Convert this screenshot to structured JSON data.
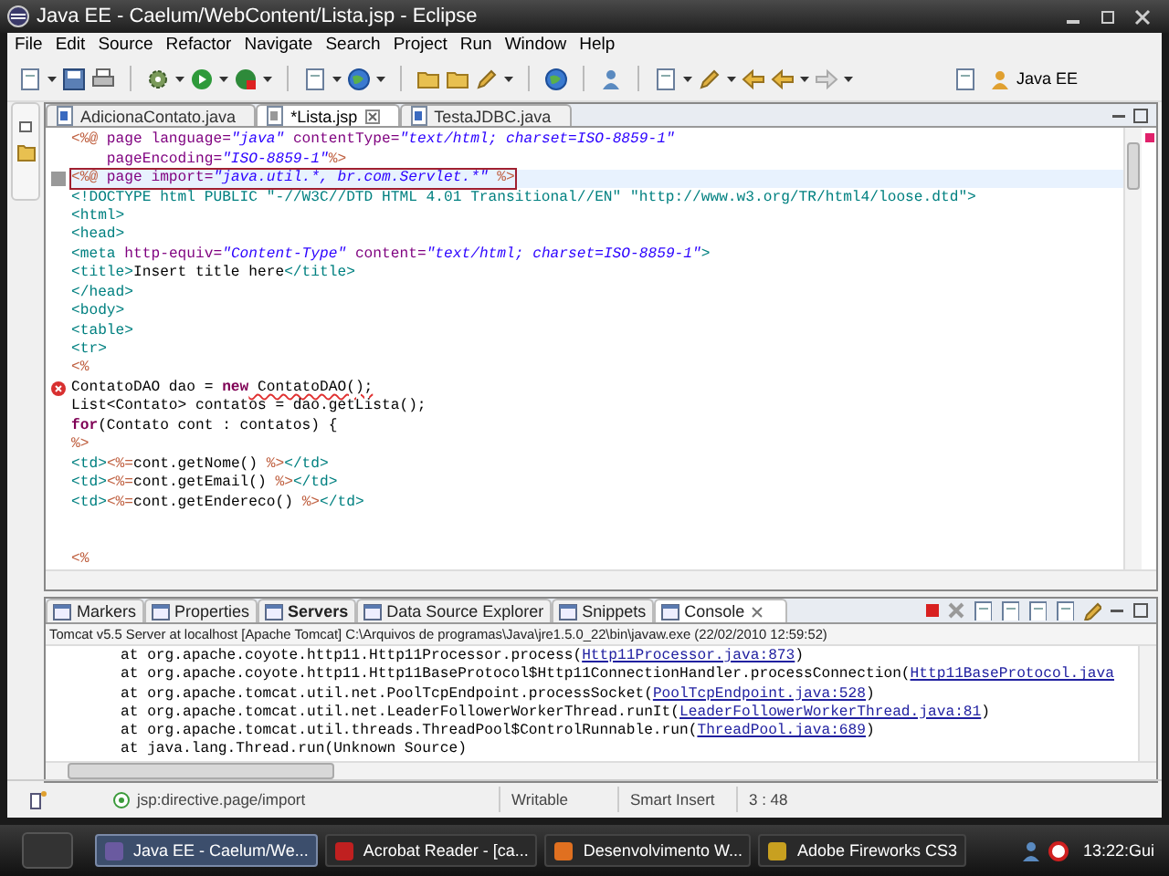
{
  "window": {
    "title": "Java EE - Caelum/WebContent/Lista.jsp - Eclipse"
  },
  "menu": [
    "File",
    "Edit",
    "Source",
    "Refactor",
    "Navigate",
    "Search",
    "Project",
    "Run",
    "Window",
    "Help"
  ],
  "perspective": {
    "label": "Java EE"
  },
  "editor": {
    "tabs": [
      {
        "label": "AdicionaContato.java",
        "selected": false,
        "kind": "java"
      },
      {
        "label": "*Lista.jsp",
        "selected": true,
        "kind": "jsp"
      },
      {
        "label": "TestaJDBC.java",
        "selected": false,
        "kind": "java"
      }
    ],
    "lines": [
      {
        "kind": "code",
        "error": false,
        "current": false,
        "segments": [
          {
            "kind": "jsp",
            "t": "<%@"
          },
          {
            "kind": "attr",
            "t": " page language="
          },
          {
            "kind": "str",
            "t": "\"java\""
          },
          {
            "kind": "attr",
            "t": " contentType="
          },
          {
            "kind": "str",
            "t": "\"text/html; charset=ISO-8859-1\""
          }
        ]
      },
      {
        "kind": "code",
        "error": false,
        "current": false,
        "segments": [
          {
            "kind": "attr",
            "t": "    pageEncoding="
          },
          {
            "kind": "str",
            "t": "\"ISO-8859-1\""
          },
          {
            "kind": "jsp",
            "t": "%>"
          }
        ]
      },
      {
        "kind": "code",
        "error": false,
        "current": true,
        "segments": [
          {
            "kind": "jsp",
            "t": "<%@"
          },
          {
            "kind": "attr",
            "t": " page import="
          },
          {
            "kind": "str",
            "t": "\"java.util.*, br.com.Servlet.*\""
          },
          {
            "kind": "jsp",
            "t": " %>"
          }
        ]
      },
      {
        "kind": "code",
        "error": false,
        "current": false,
        "segments": [
          {
            "kind": "tag",
            "t": "<!DOCTYPE html PUBLIC \"-//W3C//DTD HTML 4.01 Transitional//EN\" \"http://www.w3.org/TR/html4/loose.dtd\">"
          }
        ]
      },
      {
        "kind": "code",
        "error": false,
        "current": false,
        "segments": [
          {
            "kind": "tag",
            "t": "<html>"
          }
        ]
      },
      {
        "kind": "code",
        "error": false,
        "current": false,
        "segments": [
          {
            "kind": "tag",
            "t": "<head>"
          }
        ]
      },
      {
        "kind": "code",
        "error": false,
        "current": false,
        "segments": [
          {
            "kind": "tag",
            "t": "<meta"
          },
          {
            "kind": "attr",
            "t": " http-equiv="
          },
          {
            "kind": "str",
            "t": "\"Content-Type\""
          },
          {
            "kind": "attr",
            "t": " content="
          },
          {
            "kind": "str",
            "t": "\"text/html; charset=ISO-8859-1\""
          },
          {
            "kind": "tag",
            "t": ">"
          }
        ]
      },
      {
        "kind": "code",
        "error": false,
        "current": false,
        "segments": [
          {
            "kind": "tag",
            "t": "<title>"
          },
          {
            "kind": "plain",
            "t": "Insert title here"
          },
          {
            "kind": "tag",
            "t": "</title>"
          }
        ]
      },
      {
        "kind": "code",
        "error": false,
        "current": false,
        "segments": [
          {
            "kind": "tag",
            "t": "</head>"
          }
        ]
      },
      {
        "kind": "code",
        "error": false,
        "current": false,
        "segments": [
          {
            "kind": "tag",
            "t": "<body>"
          }
        ]
      },
      {
        "kind": "code",
        "error": false,
        "current": false,
        "segments": [
          {
            "kind": "tag",
            "t": "<table>"
          }
        ]
      },
      {
        "kind": "code",
        "error": false,
        "current": false,
        "segments": [
          {
            "kind": "tag",
            "t": "<tr>"
          }
        ]
      },
      {
        "kind": "code",
        "error": false,
        "current": false,
        "segments": [
          {
            "kind": "jsp",
            "t": "<%"
          }
        ]
      },
      {
        "kind": "code",
        "error": true,
        "current": false,
        "segments": [
          {
            "kind": "plain",
            "t": "ContatoDAO dao = "
          },
          {
            "kind": "kw",
            "t": "new"
          },
          {
            "kind": "plain",
            "t": " ContatoDAO();"
          }
        ]
      },
      {
        "kind": "code",
        "error": false,
        "current": false,
        "segments": [
          {
            "kind": "plain",
            "t": "List<Contato> contatos = dao.getLista();"
          }
        ]
      },
      {
        "kind": "code",
        "error": false,
        "current": false,
        "segments": [
          {
            "kind": "kw",
            "t": "for"
          },
          {
            "kind": "plain",
            "t": "(Contato cont : contatos) {"
          }
        ]
      },
      {
        "kind": "code",
        "error": false,
        "current": false,
        "segments": [
          {
            "kind": "jsp",
            "t": "%>"
          }
        ]
      },
      {
        "kind": "code",
        "error": false,
        "current": false,
        "segments": [
          {
            "kind": "tag",
            "t": "<td>"
          },
          {
            "kind": "jsp",
            "t": "<%="
          },
          {
            "kind": "plain",
            "t": "cont.getNome() "
          },
          {
            "kind": "jsp",
            "t": "%>"
          },
          {
            "kind": "tag",
            "t": "</td>"
          }
        ]
      },
      {
        "kind": "code",
        "error": false,
        "current": false,
        "segments": [
          {
            "kind": "tag",
            "t": "<td>"
          },
          {
            "kind": "jsp",
            "t": "<%="
          },
          {
            "kind": "plain",
            "t": "cont.getEmail() "
          },
          {
            "kind": "jsp",
            "t": "%>"
          },
          {
            "kind": "tag",
            "t": "</td>"
          }
        ]
      },
      {
        "kind": "code",
        "error": false,
        "current": false,
        "segments": [
          {
            "kind": "tag",
            "t": "<td>"
          },
          {
            "kind": "jsp",
            "t": "<%="
          },
          {
            "kind": "plain",
            "t": "cont.getEndereco() "
          },
          {
            "kind": "jsp",
            "t": "%>"
          },
          {
            "kind": "tag",
            "t": "</td>"
          }
        ]
      },
      {
        "kind": "blank"
      },
      {
        "kind": "blank"
      },
      {
        "kind": "code",
        "error": false,
        "current": false,
        "segments": [
          {
            "kind": "jsp",
            "t": "<%"
          }
        ]
      }
    ]
  },
  "panel": {
    "tabs": [
      {
        "label": "Markers",
        "selected": false,
        "bold": false
      },
      {
        "label": "Properties",
        "selected": false,
        "bold": false
      },
      {
        "label": "Servers",
        "selected": false,
        "bold": true
      },
      {
        "label": "Data Source Explorer",
        "selected": false,
        "bold": false
      },
      {
        "label": "Snippets",
        "selected": false,
        "bold": false
      },
      {
        "label": "Console",
        "selected": true,
        "bold": false
      }
    ],
    "console_title": "Tomcat v5.5 Server at localhost [Apache Tomcat] C:\\Arquivos de programas\\Java\\jre1.5.0_22\\bin\\javaw.exe (22/02/2010 12:59:52)",
    "console_lines": [
      [
        {
          "t": "at org.apache.coyote.http11.Http11Processor.process(",
          "link": false
        },
        {
          "t": "Http11Processor.java:873",
          "link": true
        },
        {
          "t": ")",
          "link": false
        }
      ],
      [
        {
          "t": "at org.apache.coyote.http11.Http11BaseProtocol$Http11ConnectionHandler.processConnection(",
          "link": false
        },
        {
          "t": "Http11BaseProtocol.java",
          "link": true
        }
      ],
      [
        {
          "t": "at org.apache.tomcat.util.net.PoolTcpEndpoint.processSocket(",
          "link": false
        },
        {
          "t": "PoolTcpEndpoint.java:528",
          "link": true
        },
        {
          "t": ")",
          "link": false
        }
      ],
      [
        {
          "t": "at org.apache.tomcat.util.net.LeaderFollowerWorkerThread.runIt(",
          "link": false
        },
        {
          "t": "LeaderFollowerWorkerThread.java:81",
          "link": true
        },
        {
          "t": ")",
          "link": false
        }
      ],
      [
        {
          "t": "at org.apache.tomcat.util.threads.ThreadPool$ControlRunnable.run(",
          "link": false
        },
        {
          "t": "ThreadPool.java:689",
          "link": true
        },
        {
          "t": ")",
          "link": false
        }
      ],
      [
        {
          "t": "at java.lang.Thread.run(Unknown Source)",
          "link": false
        }
      ]
    ]
  },
  "status_bar": {
    "element": "jsp:directive.page/import",
    "writable": "Writable",
    "insert_mode": "Smart Insert",
    "position": "3 : 48"
  },
  "taskbar": {
    "items": [
      {
        "label": "Java EE - Caelum/We...",
        "selected": true
      },
      {
        "label": "Acrobat Reader - [ca...",
        "selected": false
      },
      {
        "label": "Desenvolvimento W...",
        "selected": false
      },
      {
        "label": "Adobe Fireworks CS3",
        "selected": false
      }
    ],
    "clock": "13:22:Gui"
  }
}
